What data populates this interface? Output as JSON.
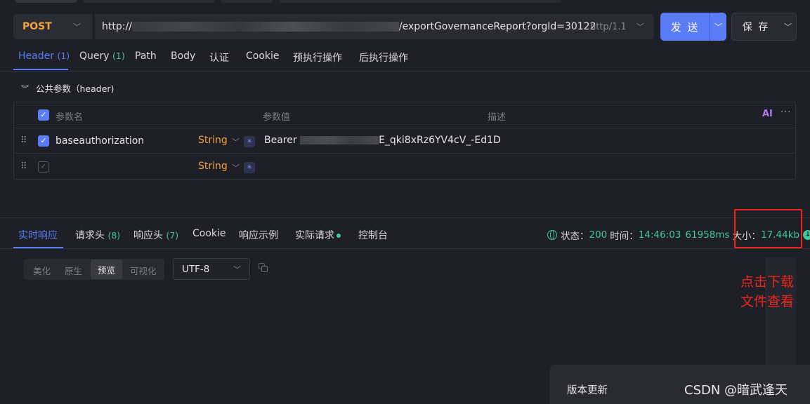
{
  "request": {
    "method": "POST",
    "url_prefix": "http://",
    "url_suffix": "/exportGovernanceReport?orgId=30122",
    "protocol": "http/1.1",
    "send_label": "发 送",
    "save_label": "保 存"
  },
  "request_tabs": [
    {
      "label": "Header",
      "count": "(1)"
    },
    {
      "label": "Query",
      "count": "(1)"
    },
    {
      "label": "Path",
      "count": ""
    },
    {
      "label": "Body",
      "count": ""
    },
    {
      "label": "认证",
      "count": ""
    },
    {
      "label": "Cookie",
      "count": ""
    },
    {
      "label": "预执行操作",
      "count": ""
    },
    {
      "label": "后执行操作",
      "count": ""
    }
  ],
  "public_params": {
    "title": "公共参数（header)",
    "columns": {
      "name": "参数名",
      "value": "参数值",
      "desc": "描述"
    },
    "ai_label": "AI",
    "rows": [
      {
        "name": "baseauthorization",
        "type": "String",
        "value_prefix": "Bearer ",
        "value_suffix": "E_qki8xRz6YV4cV_-Ed1D",
        "checked": true
      },
      {
        "name": "",
        "type": "String",
        "value_prefix": "",
        "value_suffix": "",
        "checked": false
      }
    ]
  },
  "response_tabs": [
    {
      "label": "实时响应",
      "count": ""
    },
    {
      "label": "请求头",
      "count": "(8)"
    },
    {
      "label": "响应头",
      "count": "(7)"
    },
    {
      "label": "Cookie",
      "count": ""
    },
    {
      "label": "响应示例",
      "count": ""
    },
    {
      "label": "实际请求",
      "count": ""
    },
    {
      "label": "控制台",
      "count": ""
    }
  ],
  "status": {
    "status_label": "状态：",
    "status_value": "200",
    "time_label": "时间：",
    "time_value": "14:46:03",
    "duration": "61958ms",
    "size_label": "大小：",
    "size_value": "17.44kb"
  },
  "view_modes": [
    "美化",
    "原生",
    "预览",
    "可视化"
  ],
  "selected_view": "预览",
  "encoding": "UTF-8",
  "annotation": {
    "line1": "点击下载",
    "line2": "文件查看"
  },
  "version_update": "版本更新",
  "watermark": "CSDN @暗武逢天",
  "colors": {
    "accent": "#5b7cf7",
    "success": "#3fc89a",
    "method": "#f2a33a",
    "highlight": "#e8281f"
  }
}
